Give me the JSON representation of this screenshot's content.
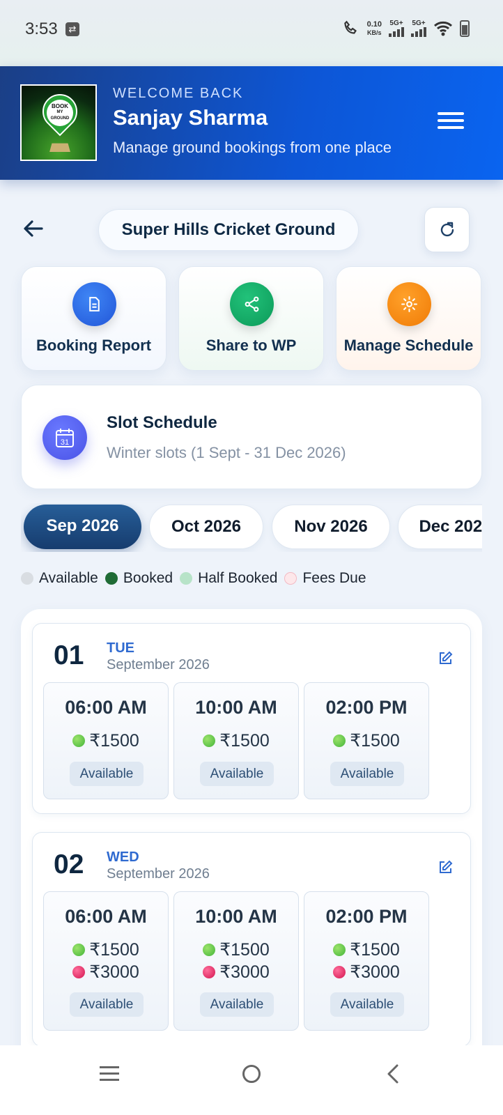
{
  "status_bar": {
    "time": "3:53",
    "speed_value": "0.10",
    "speed_unit": "KB/s",
    "network_1": "5G+",
    "network_2": "5G+"
  },
  "header": {
    "welcome": "WELCOME BACK",
    "user_name": "Sanjay Sharma",
    "tagline": "Manage ground bookings from one place",
    "logo_text": [
      "BOOK",
      "MY",
      "GROUND"
    ]
  },
  "ground": {
    "name": "Super Hills Cricket Ground"
  },
  "actions": [
    {
      "label": "Booking Report",
      "icon": "document-icon"
    },
    {
      "label": "Share to WP",
      "icon": "share-icon"
    },
    {
      "label": "Manage Schedule",
      "icon": "gear-icon"
    }
  ],
  "schedule": {
    "title": "Slot Schedule",
    "subtitle": "Winter slots (1 Sept - 31 Dec 2026)",
    "calendar_day": "31"
  },
  "months": [
    {
      "label": "Sep 2026",
      "active": true
    },
    {
      "label": "Oct 2026",
      "active": false
    },
    {
      "label": "Nov 2026",
      "active": false
    },
    {
      "label": "Dec 2026",
      "active": false
    }
  ],
  "legend": [
    {
      "label": "Available",
      "color": "#d9dde2"
    },
    {
      "label": "Booked",
      "color": "#1f6b35"
    },
    {
      "label": "Half Booked",
      "color": "#b7e3c8"
    },
    {
      "label": "Fees Due",
      "color": "#fde7ea"
    }
  ],
  "days": [
    {
      "num": "01",
      "weekday": "TUE",
      "month": "September 2026",
      "slots": [
        {
          "time": "06:00 AM",
          "prices": [
            "₹1500"
          ],
          "status": "Available"
        },
        {
          "time": "10:00 AM",
          "prices": [
            "₹1500"
          ],
          "status": "Available"
        },
        {
          "time": "02:00 PM",
          "prices": [
            "₹1500"
          ],
          "status": "Available"
        }
      ]
    },
    {
      "num": "02",
      "weekday": "WED",
      "month": "September 2026",
      "slots": [
        {
          "time": "06:00 AM",
          "prices": [
            "₹1500",
            "₹3000"
          ],
          "status": "Available"
        },
        {
          "time": "10:00 AM",
          "prices": [
            "₹1500",
            "₹3000"
          ],
          "status": "Available"
        },
        {
          "time": "02:00 PM",
          "prices": [
            "₹1500",
            "₹3000"
          ],
          "status": "Available"
        }
      ]
    }
  ]
}
